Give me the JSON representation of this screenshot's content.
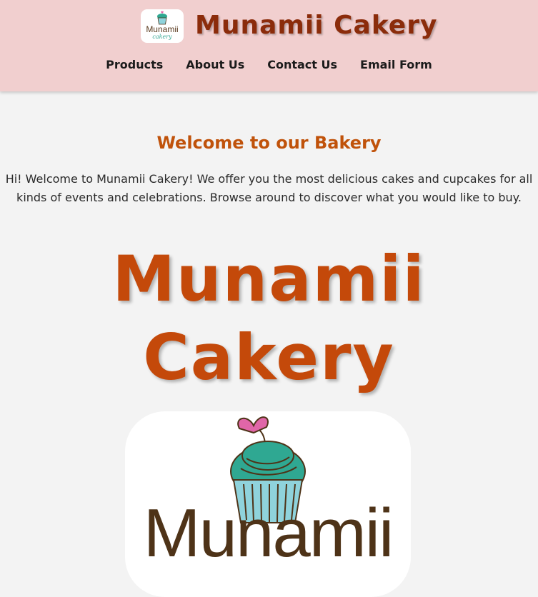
{
  "header": {
    "title": "Munamii Cakery",
    "logo": {
      "word": "Munamii",
      "sub": "cakery",
      "icon": "cupcake-icon"
    },
    "nav": [
      {
        "label": "Products"
      },
      {
        "label": "About Us"
      },
      {
        "label": "Contact Us"
      },
      {
        "label": "Email Form"
      }
    ]
  },
  "main": {
    "heading": "Welcome to our Bakery",
    "intro": "Hi! Welcome to Munamii Cakery! We offer you the most delicious cakes and cupcakes for all kinds of events and celebrations. Browse around to discover what you would like to buy.",
    "big_title": "Munamii Cakery",
    "logo_word": "Munamii"
  },
  "colors": {
    "header_bg": "#f1cfcf",
    "title": "#8b2c0b",
    "accent": "#c4490a",
    "cupcake_frosting": "#2fa892",
    "cupcake_liner": "#8fd3dc",
    "heart": "#e066a8"
  }
}
